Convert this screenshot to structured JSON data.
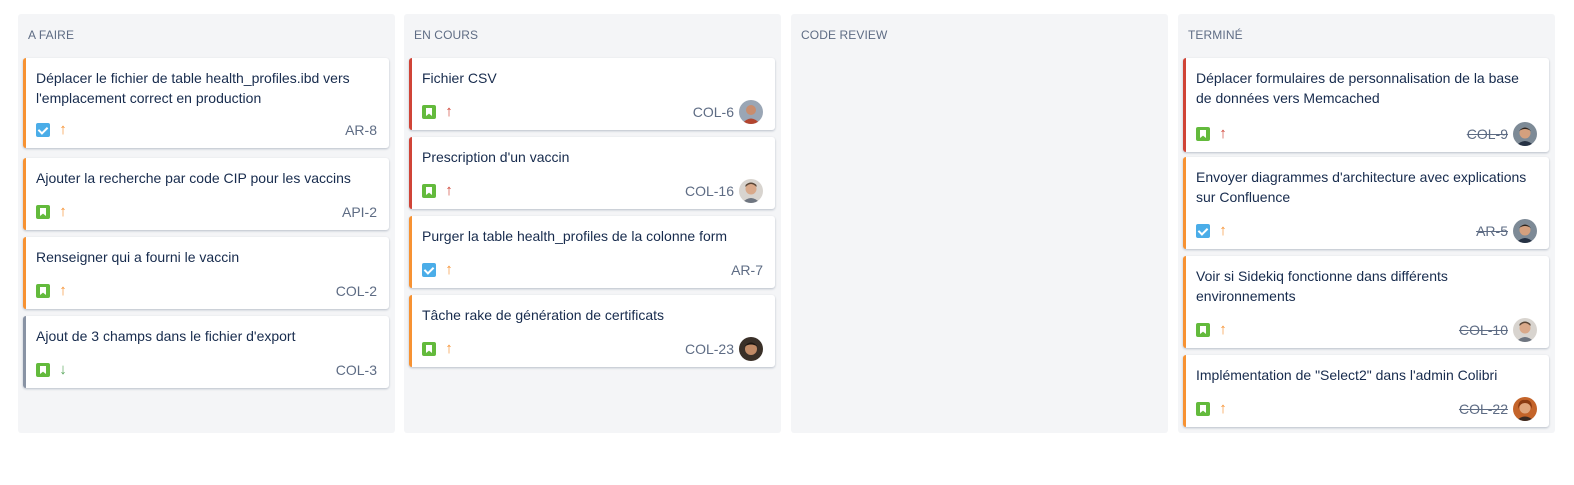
{
  "columns": [
    {
      "title": "A FAIRE",
      "cards": [
        {
          "title": "Déplacer le fichier de table health_profiles.ibd vers l'emplacement correct en production",
          "type": "task-icon",
          "priority": "high",
          "priority_glyph": "↑",
          "key": "AR-8"
        },
        {
          "title": "Ajouter la recherche par code CIP pour les vaccins",
          "type": "story-icon",
          "priority": "high",
          "priority_glyph": "↑",
          "key": "API-2"
        },
        {
          "title": "Renseigner qui a fourni le vaccin",
          "type": "story-icon",
          "priority": "high",
          "priority_glyph": "↑",
          "key": "COL-2"
        },
        {
          "title": "Ajout de 3 champs dans le fichier d'export",
          "type": "story-icon",
          "priority": "low",
          "priority_glyph": "↓",
          "key": "COL-3"
        }
      ]
    },
    {
      "title": "EN COURS",
      "cards": [
        {
          "title": "Fichier CSV",
          "type": "story-icon",
          "priority": "highest",
          "priority_glyph": "↑",
          "key": "COL-6",
          "avatar": "avatar-a"
        },
        {
          "title": "Prescription d'un vaccin",
          "type": "story-icon",
          "priority": "highest",
          "priority_glyph": "↑",
          "key": "COL-16",
          "avatar": "avatar-b"
        },
        {
          "title": "Purger la table health_profiles de la colonne form",
          "type": "task-icon",
          "priority": "high",
          "priority_glyph": "↑",
          "key": "AR-7"
        },
        {
          "title": "Tâche rake de génération de certificats",
          "type": "story-icon",
          "priority": "high",
          "priority_glyph": "↑",
          "key": "COL-23",
          "avatar": "avatar-c"
        }
      ]
    },
    {
      "title": "CODE REVIEW",
      "cards": []
    },
    {
      "title": "TERMINÉ",
      "cards": [
        {
          "title": "Déplacer formulaires de personnalisation de la base de données vers Memcached",
          "type": "story-icon",
          "priority": "highest",
          "priority_glyph": "↑",
          "key": "COL-9",
          "avatar": "avatar-d"
        },
        {
          "title": "Envoyer diagrammes d'architecture avec explications sur Confluence",
          "type": "task-icon",
          "priority": "high",
          "priority_glyph": "↑",
          "key": "AR-5",
          "avatar": "avatar-d"
        },
        {
          "title": "Voir si Sidekiq fonctionne dans différents environnements",
          "type": "story-icon",
          "priority": "high",
          "priority_glyph": "↑",
          "key": "COL-10",
          "avatar": "avatar-b"
        },
        {
          "title": "Implémentation de \"Select2\" dans l'admin Colibri",
          "type": "story-icon",
          "priority": "high",
          "priority_glyph": "↑",
          "key": "COL-22",
          "avatar": "avatar-e"
        }
      ]
    }
  ],
  "colors": {
    "column_bg": "#f4f5f7",
    "priority_highest": "#d04437",
    "priority_high": "#f79232",
    "priority_low": "#8993a4",
    "priority_low_arrow": "#57a55a",
    "story": "#63ba3c",
    "task": "#4bade8"
  }
}
